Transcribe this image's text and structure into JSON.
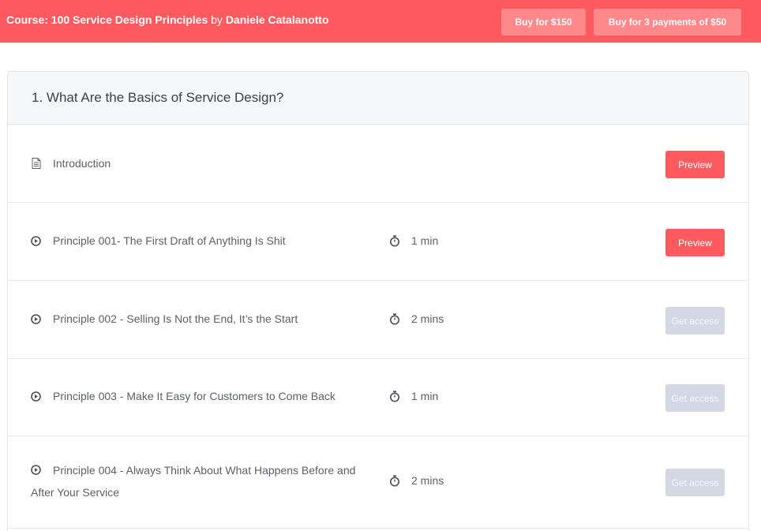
{
  "header": {
    "course_prefix": "Course: 100 Service Design Principles",
    "by_text": " by ",
    "author": "Daniele Catalanotto",
    "buy_full_label": "Buy for $150",
    "buy_installments_label": "Buy for 3 payments of $50",
    "accent_color": "#ff5a5f"
  },
  "section": {
    "title": "1. What Are the Basics of Service Design?",
    "lessons": [
      {
        "icon": "document-icon",
        "title": "Introduction",
        "duration": "",
        "action": "Preview"
      },
      {
        "icon": "play-icon",
        "title": "Principle 001- The First Draft of Anything Is Shit",
        "duration": "1 min",
        "action": "Preview"
      },
      {
        "icon": "play-icon",
        "title": "Principle 002 - Selling Is Not the End, It’s the Start",
        "duration": "2 mins",
        "action": "Get access"
      },
      {
        "icon": "play-icon",
        "title": "Principle 003 - Make It Easy for Customers to Come Back",
        "duration": "1 min",
        "action": "Get access"
      },
      {
        "icon": "play-icon",
        "title": "Principle 004 - Always Think About What Happens Before and After Your Service",
        "duration": "2 mins",
        "action": "Get access"
      }
    ]
  }
}
